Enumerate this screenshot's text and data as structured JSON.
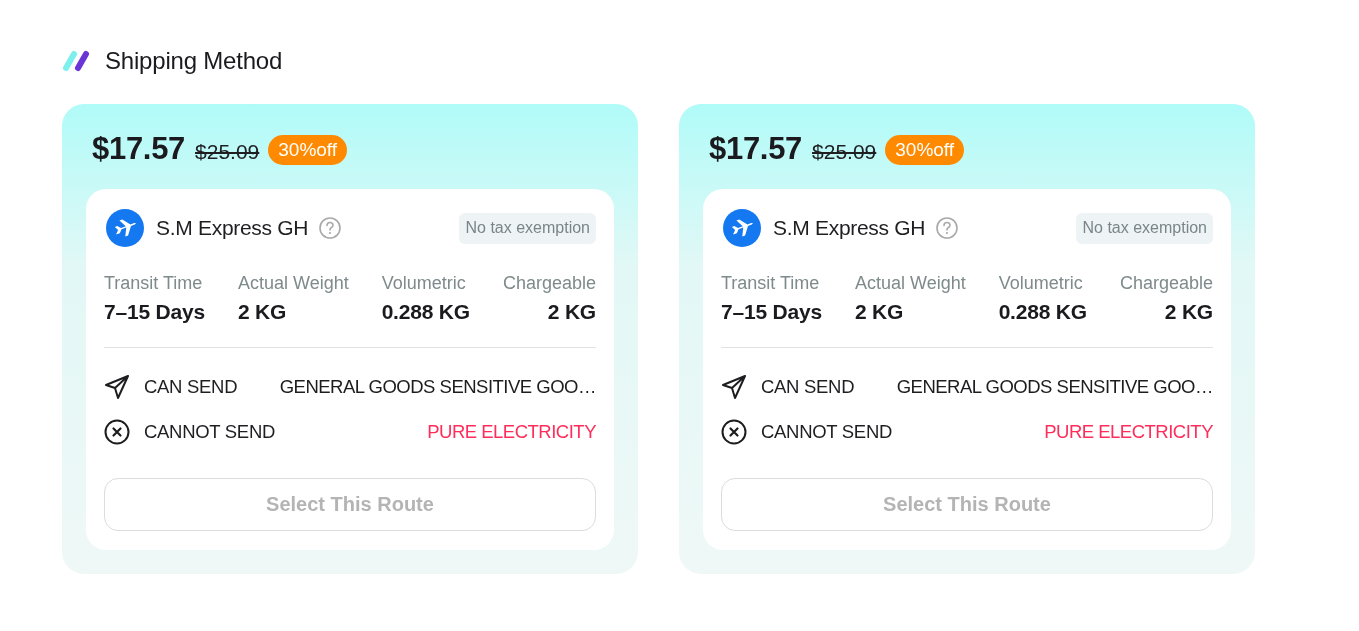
{
  "header": {
    "title": "Shipping Method"
  },
  "routes": [
    {
      "price": "$17.57",
      "original_price": "$25.09",
      "discount": "30%off",
      "carrier": {
        "name": "S.M Express GH",
        "tag": "No tax exemption"
      },
      "stats": [
        {
          "label": "Transit Time",
          "value": "7–15 Days"
        },
        {
          "label": "Actual Weight",
          "value": "2 KG"
        },
        {
          "label": "Volumetric",
          "value": "0.288 KG"
        },
        {
          "label": "Chargeable",
          "value": "2 KG"
        }
      ],
      "rules": [
        {
          "kind": "allowed",
          "label": "CAN SEND",
          "value": "GENERAL GOODS SENSITIVE GOO…"
        },
        {
          "kind": "forbidden",
          "label": "CANNOT SEND",
          "value": "PURE ELECTRICITY"
        }
      ],
      "button": {
        "label": "Select This Route",
        "disabled": true
      }
    },
    {
      "price": "$17.57",
      "original_price": "$25.09",
      "discount": "30%off",
      "carrier": {
        "name": "S.M Express GH",
        "tag": "No tax exemption"
      },
      "stats": [
        {
          "label": "Transit Time",
          "value": "7–15 Days"
        },
        {
          "label": "Actual Weight",
          "value": "2 KG"
        },
        {
          "label": "Volumetric",
          "value": "0.288 KG"
        },
        {
          "label": "Chargeable",
          "value": "2 KG"
        }
      ],
      "rules": [
        {
          "kind": "allowed",
          "label": "CAN SEND",
          "value": "GENERAL GOODS SENSITIVE GOO…"
        },
        {
          "kind": "forbidden",
          "label": "CANNOT SEND",
          "value": "PURE ELECTRICITY"
        }
      ],
      "button": {
        "label": "Select This Route",
        "disabled": true
      }
    }
  ]
}
